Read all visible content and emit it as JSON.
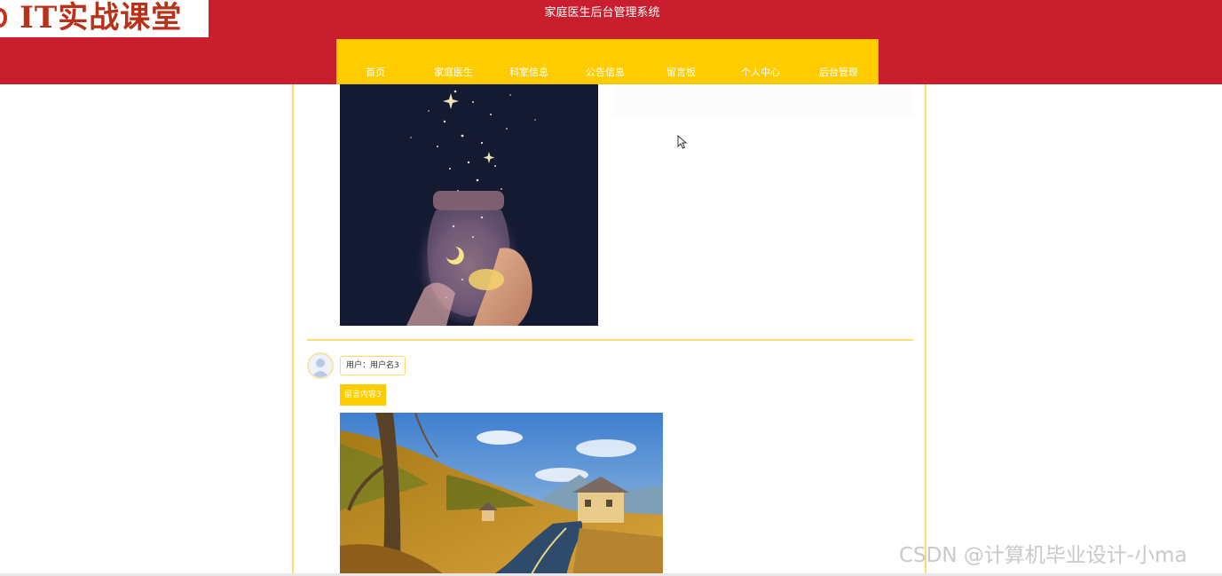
{
  "logo": {
    "text": "IT实战课堂"
  },
  "header": {
    "title": "家庭医生后台管理系统"
  },
  "nav": {
    "items": [
      {
        "label": "首页"
      },
      {
        "label": "家庭医生"
      },
      {
        "label": "科室信息"
      },
      {
        "label": "公告信息"
      },
      {
        "label": "留言板"
      },
      {
        "label": "个人中心"
      },
      {
        "label": "后台管理"
      }
    ]
  },
  "messages": [
    {
      "image": "starry-jar-image"
    },
    {
      "user_label": "用户：用户名3",
      "content": "留言内容3",
      "image": "country-road-house-image"
    }
  ],
  "watermark": {
    "text": "CSDN @计算机毕业设计-小ma"
  },
  "colors": {
    "header": "#c81e2d",
    "nav": "#ffcc00",
    "border": "#ffdb76"
  }
}
